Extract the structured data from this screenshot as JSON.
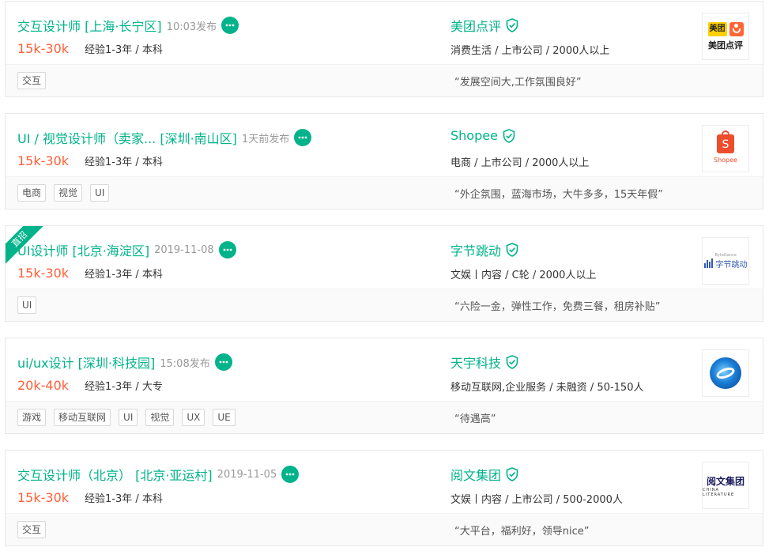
{
  "jobs": [
    {
      "title": "交互设计师 [上海·长宁区]",
      "publish_time": "10:03发布",
      "salary": "15k-30k",
      "requirement": "经验1-3年 / 本科",
      "company": "美团点评",
      "industry": "消费生活 / 上市公司 / 2000人以上",
      "tags": [
        "交互"
      ],
      "advantage": "“发展空间大,工作氛围良好”",
      "logo": {
        "line1": "美团",
        "line2": "美团点评"
      }
    },
    {
      "title": "UI / 视觉设计师（卖家... [深圳·南山区]",
      "publish_time": "1天前发布",
      "salary": "15k-30k",
      "requirement": "经验1-3年 / 本科",
      "company": "Shopee",
      "industry": "电商 / 上市公司 / 2000人以上",
      "tags": [
        "电商",
        "视觉",
        "UI"
      ],
      "advantage": "“外企氛围，蓝海市场，大牛多多，15天年假”",
      "logo": {
        "glyph": "S",
        "text": "Shopee"
      }
    },
    {
      "badge": "直招",
      "title": "UI设计师 [北京·海淀区]",
      "publish_time": "2019-11-08",
      "salary": "15k-30k",
      "requirement": "经验1-3年 / 本科",
      "company": "字节跳动",
      "industry": "文娱丨内容 / C轮 / 2000人以上",
      "tags": [
        "UI"
      ],
      "advantage": "“六险一金，弹性工作，免费三餐，租房补贴”",
      "logo": {
        "small": "ByteDance",
        "text": "字节跳动"
      }
    },
    {
      "title": "ui/ux设计 [深圳·科技园]",
      "publish_time": "15:08发布",
      "salary": "20k-40k",
      "requirement": "经验1-3年 / 大专",
      "company": "天宇科技",
      "industry": "移动互联网,企业服务 / 未融资 / 50-150人",
      "tags": [
        "游戏",
        "移动互联网",
        "UI",
        "视觉",
        "UX",
        "UE"
      ],
      "advantage": "“待遇高”"
    },
    {
      "title": "交互设计师（北京） [北京·亚运村]",
      "publish_time": "2019-11-05",
      "salary": "15k-30k",
      "requirement": "经验1-3年 / 本科",
      "company": "阅文集团",
      "industry": "文娱丨内容 / 上市公司 / 500-2000人",
      "tags": [
        "交互"
      ],
      "advantage": "“大平台，福利好，领导nice”",
      "logo": {
        "main": "阅文集团",
        "sub": "CHINA LITERATURE"
      }
    }
  ],
  "colors": {
    "accent": "#00b38a",
    "salary": "#fd5f39"
  }
}
